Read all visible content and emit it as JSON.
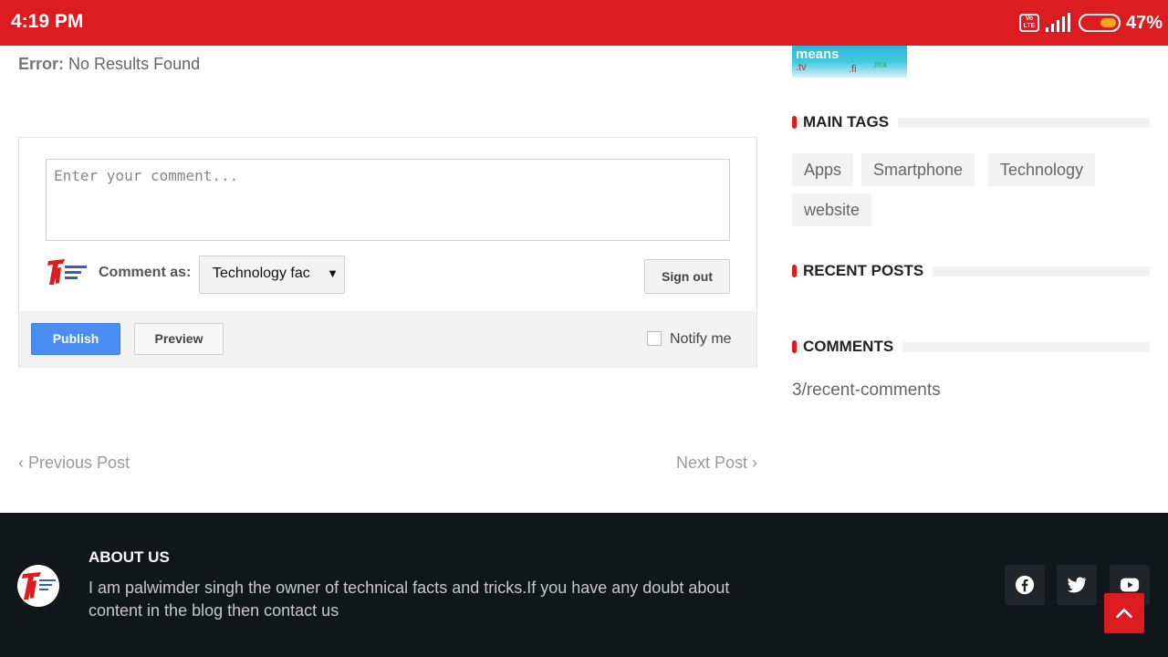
{
  "status_bar": {
    "time": "4:19 PM",
    "volte": "Vo LTE",
    "battery_percent": "47%",
    "battery_level": 0.47
  },
  "post": {
    "error_label": "Error:",
    "error_message": "No Results Found"
  },
  "comment_form": {
    "placeholder": "Enter your comment...",
    "comment_as_label": "Comment as:",
    "identity_value": "Technology fac",
    "sign_out_label": "Sign out",
    "publish_label": "Publish",
    "preview_label": "Preview",
    "notify_label": "Notify me",
    "notify_checked": false
  },
  "post_nav": {
    "previous_label": "Previous Post",
    "next_label": "Next Post"
  },
  "sidebar": {
    "thumb_text": {
      "word": "means",
      "tld1": ".tv",
      "tld2": ".fi",
      "tld3": ".mx"
    },
    "main_tags_title": "MAIN TAGS",
    "tags": [
      "Apps",
      "Smartphone",
      "Technology",
      "website"
    ],
    "recent_posts_title": "RECENT POSTS",
    "comments_title": "COMMENTS",
    "recent_comments_text": "3/recent-comments"
  },
  "footer": {
    "about_title": "ABOUT US",
    "about_text": "I am palwimder singh the owner of technical facts and tricks.If you have any doubt about content in the blog then contact us",
    "social_icons": [
      "facebook-icon",
      "twitter-icon",
      "youtube-icon"
    ]
  },
  "colors": {
    "brand_red": "#dc1c20",
    "publish_blue": "#4a8df0",
    "footer_bg": "#111618"
  }
}
